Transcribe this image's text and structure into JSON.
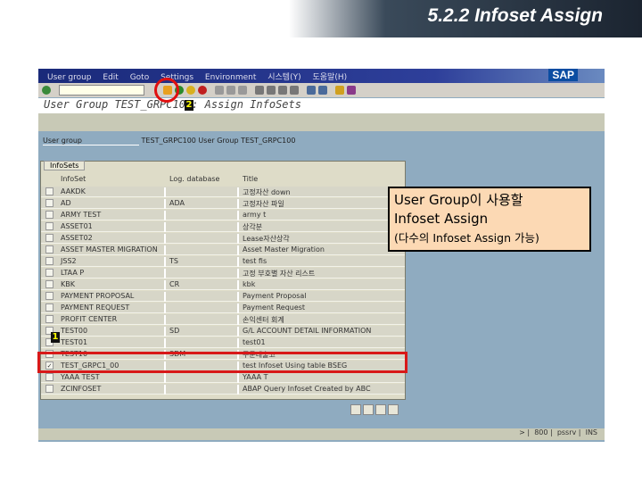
{
  "slide_title": "5.2.2 Infoset Assign",
  "menu": [
    "User group",
    "Edit",
    "Goto",
    "Settings",
    "Environment",
    "시스템(Y)",
    "도움말(H)"
  ],
  "sap_logo": "SAP",
  "screen_title": "User Group TEST_GRPC100: Assign InfoSets",
  "user_group": {
    "label": "User group",
    "value": "TEST_GRPC100 User Group TEST_GRPC100"
  },
  "table": {
    "tab": "InfoSets",
    "headers": [
      "InfoSet",
      "Log. database",
      "Title"
    ],
    "rows": [
      {
        "infoset": "AAKDK",
        "ldb": "",
        "title": "고정자산 down",
        "checked": false
      },
      {
        "infoset": "AD",
        "ldb": "ADA",
        "title": "고정자산 파일",
        "checked": false
      },
      {
        "infoset": "ARMY TEST",
        "ldb": "",
        "title": "army t",
        "checked": false
      },
      {
        "infoset": "ASSET01",
        "ldb": "",
        "title": "상각분",
        "checked": false
      },
      {
        "infoset": "ASSET02",
        "ldb": "",
        "title": "Lease자산상각",
        "checked": false
      },
      {
        "infoset": "ASSET MASTER MIGRATION",
        "ldb": "",
        "title": "Asset Master Migration",
        "checked": false
      },
      {
        "infoset": "JSS2",
        "ldb": "TS",
        "title": "test fis",
        "checked": false
      },
      {
        "infoset": "LTAA P",
        "ldb": "",
        "title": "고정 부호별 자산 리스트",
        "checked": false
      },
      {
        "infoset": "KBK",
        "ldb": "CR",
        "title": "kbk",
        "checked": false
      },
      {
        "infoset": "PAYMENT PROPOSAL",
        "ldb": "",
        "title": "Payment Proposal",
        "checked": false
      },
      {
        "infoset": "PAYMENT REQUEST",
        "ldb": "",
        "title": "Payment Request",
        "checked": false
      },
      {
        "infoset": "PROFIT CENTER",
        "ldb": "",
        "title": "손익센터 회계",
        "checked": false
      },
      {
        "infoset": "TEST00",
        "ldb": "SD",
        "title": "G/L ACCOUNT DETAIL INFORMATION",
        "checked": false
      },
      {
        "infoset": "TEST01",
        "ldb": "",
        "title": "test01",
        "checked": false
      },
      {
        "infoset": "TEST10",
        "ldb": "SDM",
        "title": "주문내출고",
        "checked": false
      },
      {
        "infoset": "TEST_GRPC1_00",
        "ldb": "",
        "title": "test Infoset Using table BSEG",
        "checked": true
      },
      {
        "infoset": "YAAA TEST",
        "ldb": "",
        "title": "YAAA T",
        "checked": false
      },
      {
        "infoset": "ZCINFOSET",
        "ldb": "",
        "title": "ABAP Query Infoset Created by ABC",
        "checked": false
      }
    ]
  },
  "status": {
    "arrow": ">",
    "system": "800",
    "user": "pssrv",
    "mode": "INS"
  },
  "callout": {
    "line1": "User Group이 사용할",
    "line2": "Infoset Assign",
    "line3": "(다수의 Infoset Assign 가능)"
  },
  "markers": {
    "m1": "1",
    "m2": "2"
  },
  "colors": {
    "highlight": "#d81818",
    "callout_bg": "#fcd9b4"
  }
}
